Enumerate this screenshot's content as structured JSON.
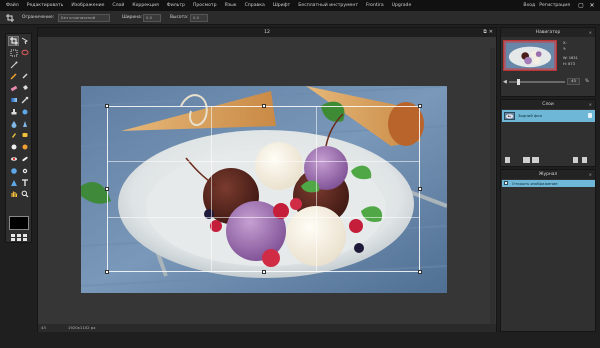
{
  "menu": {
    "items": [
      "Файл",
      "Редактировать",
      "Изображение",
      "Слой",
      "Коррекция",
      "Фильтр",
      "Просмотр",
      "Язык",
      "Справка",
      "Шрифт",
      "Бесплатный инструмент",
      "Frontira",
      "Upgrade"
    ],
    "login_label": "Вход",
    "register_label": "Регистрация"
  },
  "options": {
    "constraint_label": "Ограничение:",
    "constraint_value": "Без ограничений",
    "width_label": "Ширина:",
    "width_value": "0.0",
    "height_label": "Высота:",
    "height_value": "0.0"
  },
  "document": {
    "title": "12",
    "zoom": "43",
    "size_text": "1920x1102 px"
  },
  "navigator": {
    "title": "Навигатор",
    "x_label": "X:",
    "y_label": "Y:",
    "w_label": "W:",
    "w_value": "1631",
    "h_label": "H:",
    "h_value": "873",
    "zoom_value": "43"
  },
  "layers": {
    "title": "Слои",
    "items": [
      {
        "name": "Задний фон"
      }
    ]
  },
  "history": {
    "title": "Журнал",
    "items": [
      {
        "label": "Открыть изображение"
      }
    ]
  },
  "colors": {
    "accent": "#6fb7d6",
    "panel_bg": "#303030",
    "app_bg": "#1f1f1f"
  }
}
